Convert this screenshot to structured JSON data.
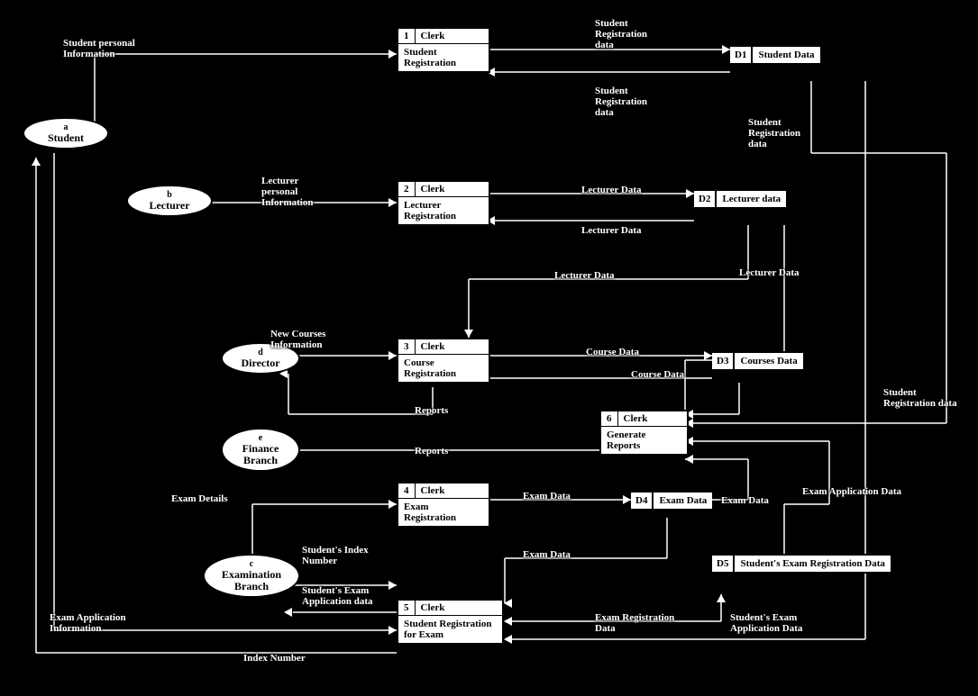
{
  "entities": {
    "a": {
      "id": "a",
      "name": "Student"
    },
    "b": {
      "id": "b",
      "name": "Lecturer"
    },
    "c": {
      "id": "c",
      "name": "Examination Branch"
    },
    "d": {
      "id": "d",
      "name": "Director"
    },
    "e": {
      "id": "e",
      "name": "Finance Branch"
    }
  },
  "processes": {
    "p1": {
      "num": "1",
      "role": "Clerk",
      "name": "Student Registration"
    },
    "p2": {
      "num": "2",
      "role": "Clerk",
      "name": "Lecturer Registration"
    },
    "p3": {
      "num": "3",
      "role": "Clerk",
      "name": "Course Registration"
    },
    "p4": {
      "num": "4",
      "role": "Clerk",
      "name": "Exam Registration"
    },
    "p5": {
      "num": "5",
      "role": "Clerk",
      "name": "Student Registration for Exam"
    },
    "p6": {
      "num": "6",
      "role": "Clerk",
      "name": "Generate Reports"
    }
  },
  "stores": {
    "d1": {
      "id": "D1",
      "name": "Student Data"
    },
    "d2": {
      "id": "D2",
      "name": "Lecturer data"
    },
    "d3": {
      "id": "D3",
      "name": "Courses Data"
    },
    "d4": {
      "id": "D4",
      "name": "Exam Data"
    },
    "d5": {
      "id": "D5",
      "name": "Student's Exam Registration Data"
    }
  },
  "flows": {
    "f1": "Student personal Information",
    "f2": "Lecturer personal Information",
    "f3": "New Courses Information",
    "f4": "Exam Details",
    "f5": "Student's Index Number",
    "f6": "Student's Exam Application data",
    "f7": "Exam Application Information",
    "f8": "Index Number",
    "f9": "Student Registration data",
    "f10": "Student Registration data",
    "f11": "Student Registration data",
    "f12": "Lecturer Data",
    "f13": "Lecturer Data",
    "f14": "Lecturer Data",
    "f15": "Lecturer Data",
    "f16": "Course Data",
    "f17": "Course Data",
    "f18": "Reports",
    "f19": "Reports",
    "f20": "Exam Data",
    "f21": "Exam Data",
    "f22": "Exam Data",
    "f23": "Exam Registration Data",
    "f24": "Exam Application Data",
    "f25": "Student Registration data",
    "f26": "Student's Exam Application Data"
  }
}
